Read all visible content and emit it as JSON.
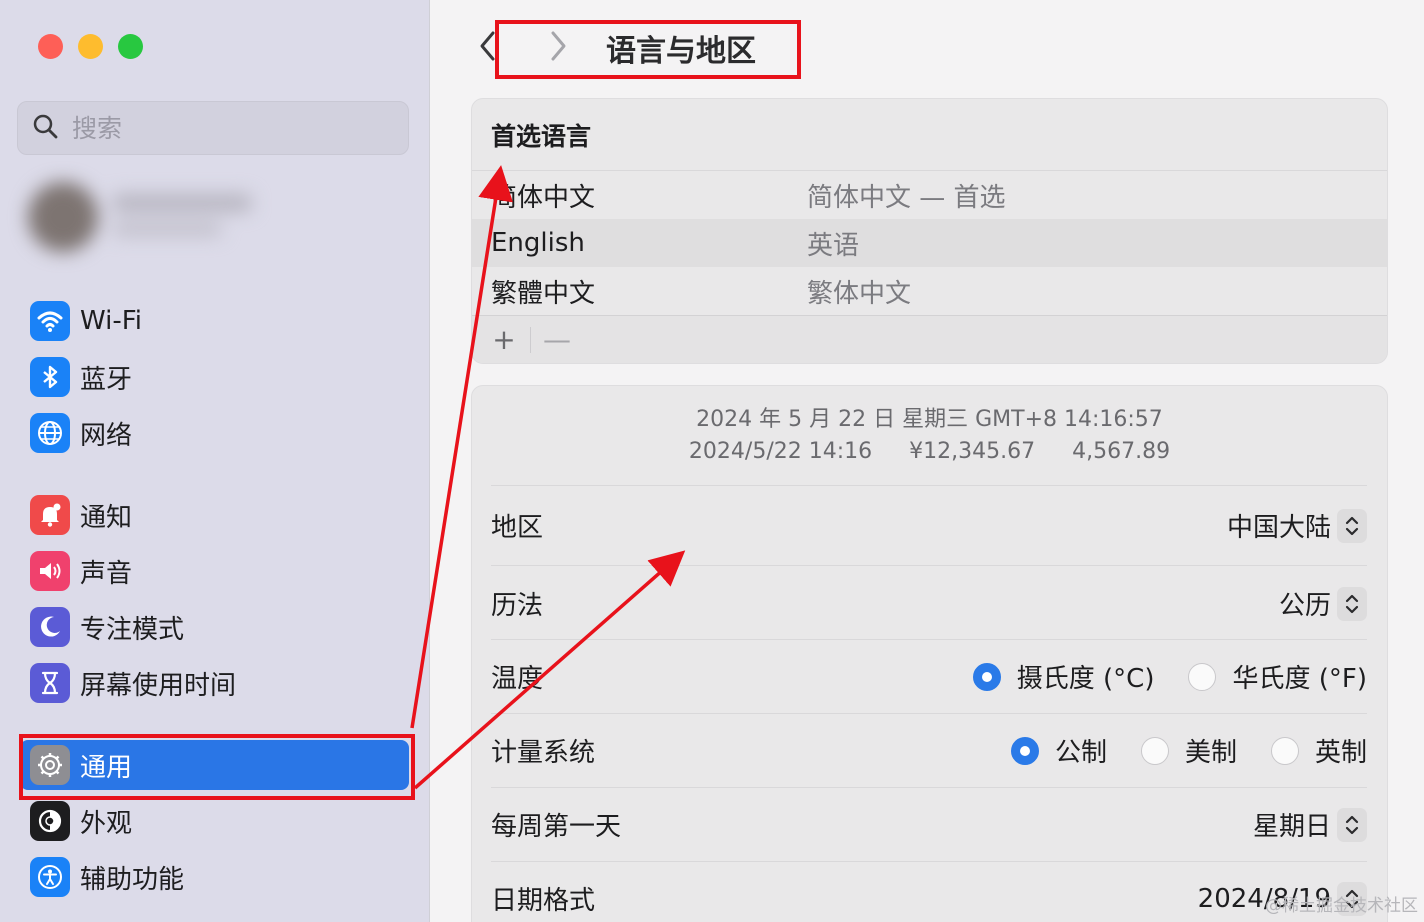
{
  "window": {
    "title": "语言与地区"
  },
  "sidebar": {
    "search_placeholder": "搜索",
    "items": [
      {
        "label": "Wi-Fi",
        "icon": "wifi-icon",
        "color": "#1a82f7"
      },
      {
        "label": "蓝牙",
        "icon": "bluetooth-icon",
        "color": "#1a82f7"
      },
      {
        "label": "网络",
        "icon": "globe-icon",
        "color": "#1a82f7"
      },
      {
        "label": "通知",
        "icon": "bell-icon",
        "color": "#f04a4a"
      },
      {
        "label": "声音",
        "icon": "speaker-icon",
        "color": "#f0416d"
      },
      {
        "label": "专注模式",
        "icon": "moon-icon",
        "color": "#5b5bd6"
      },
      {
        "label": "屏幕使用时间",
        "icon": "hourglass-icon",
        "color": "#5b5bd6"
      },
      {
        "label": "通用",
        "icon": "gear-icon",
        "color": "#8e8e93",
        "selected": true
      },
      {
        "label": "外观",
        "icon": "appearance-icon",
        "color": "#1d1d1f"
      },
      {
        "label": "辅助功能",
        "icon": "accessibility-icon",
        "color": "#1a82f7"
      }
    ]
  },
  "preferred_languages": {
    "heading": "首选语言",
    "rows": [
      {
        "name": "简体中文",
        "detail": "简体中文 — 首选"
      },
      {
        "name": "English",
        "detail": "英语"
      },
      {
        "name": "繁體中文",
        "detail": "繁体中文"
      }
    ],
    "add_label": "+",
    "remove_label": "—"
  },
  "region_preview": {
    "line1": "2024 年 5 月 22 日 星期三 GMT+8 14:16:57",
    "date_short": "2024/5/22 14:16",
    "currency": "¥12,345.67",
    "number": "4,567.89"
  },
  "settings": {
    "region": {
      "label": "地区",
      "value": "中国大陆"
    },
    "calendar": {
      "label": "历法",
      "value": "公历"
    },
    "temperature": {
      "label": "温度",
      "options": [
        "摄氏度 (°C)",
        "华氏度 (°F)"
      ],
      "selected": 0
    },
    "measurement": {
      "label": "计量系统",
      "options": [
        "公制",
        "美制",
        "英制"
      ],
      "selected": 0
    },
    "first_day": {
      "label": "每周第一天",
      "value": "星期日"
    },
    "date_format": {
      "label": "日期格式",
      "value": "2024/8/19"
    }
  },
  "watermark": "@稀土掘金技术社区",
  "accent_color": "#2a76e6",
  "annotation_color": "#e8121b"
}
